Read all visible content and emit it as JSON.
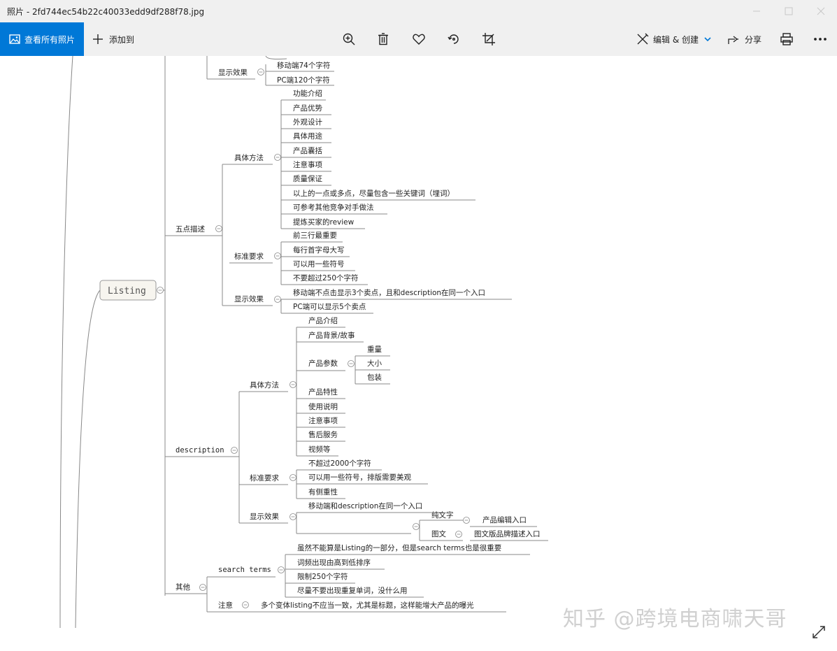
{
  "window": {
    "title": "照片 - 2fd744ec54b22c40033edd9df288f78.jpg"
  },
  "toolbar": {
    "view_all_label": "查看所有照片",
    "add_to_label": "添加到",
    "edit_create_label": "编辑 & 创建",
    "share_label": "分享",
    "accent_color": "#0078d7",
    "icons": [
      "zoom-in-icon",
      "delete-icon",
      "favorite-icon",
      "rotate-icon",
      "crop-icon",
      "edit-icon",
      "share-icon",
      "print-icon",
      "more-icon"
    ]
  },
  "mindmap": {
    "root": "Listing",
    "partial_top": {
      "display": "显示效果",
      "mobile": "移动端74个字符",
      "pc": "PC端120个字符"
    },
    "five_points": {
      "label": "五点描述",
      "method": {
        "label": "具体方法",
        "items": [
          "功能介绍",
          "产品优势",
          "外观设计",
          "具体用途",
          "产品囊括",
          "注意事项",
          "质量保证",
          "以上的一点或多点，尽量包含一些关键词（埋词）",
          "可参考其他竞争对手做法",
          "提炼买家的review"
        ]
      },
      "standard": {
        "label": "标准要求",
        "items": [
          "前三行最重要",
          "每行首字母大写",
          "可以用一些符号",
          "不要超过250个字符"
        ]
      },
      "display": {
        "label": "显示效果",
        "items": [
          "移动端不点击显示3个卖点，且和description在同一个入口",
          "PC端可以显示5个卖点"
        ]
      }
    },
    "description": {
      "label": "description",
      "method": {
        "label": "具体方法",
        "intro": "产品介绍",
        "background": "产品背景/故事",
        "params": {
          "label": "产品参数",
          "items": [
            "重量",
            "大小",
            "包装"
          ]
        },
        "rest": [
          "产品特性",
          "使用说明",
          "注意事项",
          "售后服务",
          "视频等"
        ]
      },
      "standard": {
        "label": "标准要求",
        "items": [
          "不超过2000个字符",
          "可以用一些符号，排版需要美观",
          "有侧重性"
        ]
      },
      "display": {
        "label": "显示效果",
        "mobile": "移动端和description在同一个入口",
        "plain_text": "纯文字",
        "plain_text_entry": "产品编辑入口",
        "rich": "图文",
        "rich_entry": "图文版品牌描述入口"
      }
    },
    "other": {
      "label": "其他",
      "search_terms": {
        "label": "search terms",
        "items": [
          "虽然不能算是Listing的一部分，但是search terms也是很重要",
          "词频出现由高到低排序",
          "限制250个字符",
          "尽量不要出现重复单词，没什么用"
        ]
      },
      "note": {
        "label": "注意",
        "text": "多个变体listing不应当一致，尤其是标题，这样能增大产品的曝光"
      }
    }
  },
  "watermark": "知乎 @跨境电商啸天哥"
}
